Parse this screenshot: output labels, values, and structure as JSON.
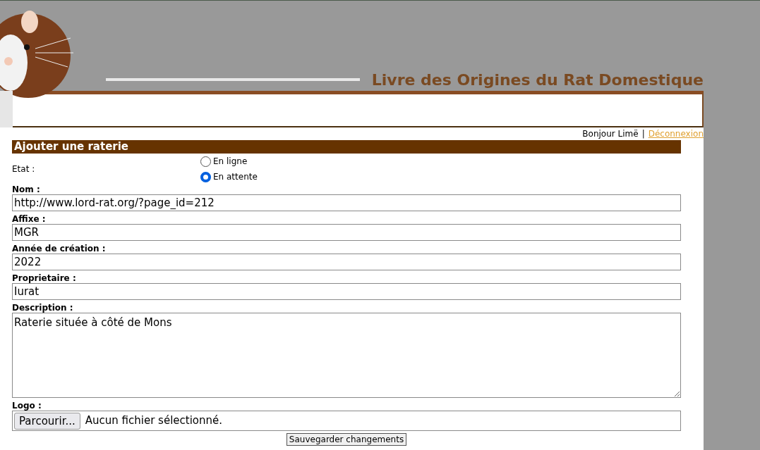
{
  "header": {
    "site_title": "Livre des Origines du Rat Domestique"
  },
  "user_bar": {
    "greeting": "Bonjour Limë",
    "separator": "|",
    "logout_link": "Déconnexion"
  },
  "form": {
    "title": "Ajouter une raterie",
    "state": {
      "label": "Etat :",
      "options": [
        {
          "label": "En ligne",
          "selected": false
        },
        {
          "label": "En attente",
          "selected": true
        }
      ]
    },
    "fields": [
      {
        "kind": "text",
        "label": "Nom :",
        "value": "http://www.lord-rat.org/?page_id=212"
      },
      {
        "kind": "text",
        "label": "Affixe :",
        "value": "MGR"
      },
      {
        "kind": "text",
        "label": "Année de création :",
        "value": "2022"
      },
      {
        "kind": "text",
        "label": "Proprietaire :",
        "value": "Iurat"
      },
      {
        "kind": "textarea",
        "label": "Description :",
        "value": "Raterie située à côté de Mons"
      },
      {
        "kind": "file",
        "label": "Logo :",
        "button": "Parcourir...",
        "value": "Aucun fichier sélectionné."
      }
    ],
    "submit": "Sauvegarder changements"
  }
}
